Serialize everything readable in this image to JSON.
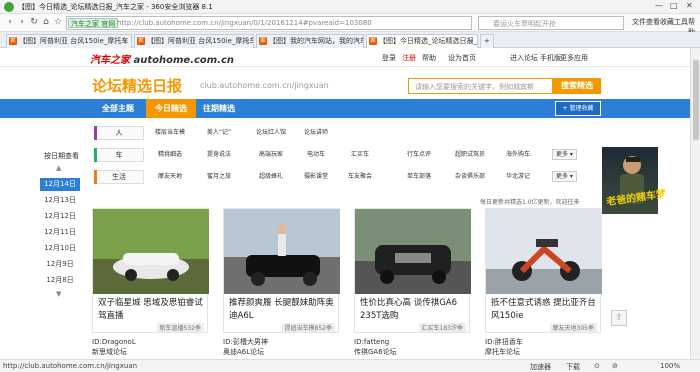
{
  "window": {
    "title": "【图】今日精选_论坛精选日报_汽车之家 - 360安全浏览器 8.1",
    "min": "—",
    "max": "□",
    "close": "✕"
  },
  "nav": {
    "back": "‹",
    "forward": "›",
    "refresh": "↻",
    "home": "⌂",
    "star": "☆",
    "security_pill": "汽车之家 官网",
    "url": "http://club.autohome.com.cn/jingxuan/0/1/20161214#pvareaid=103080",
    "search_placeholder": "春运火车票明起开抢",
    "menu": [
      "文件",
      "查看",
      "收藏",
      "工具",
      "帮助"
    ]
  },
  "tabs": [
    {
      "label": "【图】阿普利亚 台风150ie_摩托车"
    },
    {
      "label": "【图】阿普利亚 台风150ie_摩托车"
    },
    {
      "label": "【图】我的汽车网站，我的汽车之家"
    },
    {
      "label": "【图】今日精选_论坛精选日报_汽车之家"
    }
  ],
  "sitebar": {
    "brand_red": "汽车之家",
    "brand_domain": "autohome.com.cn",
    "links": [
      "登录",
      "注册",
      "帮助",
      "设为首页",
      "进入论坛",
      "手机版",
      "更多应用"
    ]
  },
  "header": {
    "title": "论坛精选日报",
    "subtitle": "club.autohome.com.cn/jingxuan",
    "search_placeholder": "请输入您要搜索的关键字，例如城宾斯",
    "search_button": "搜索精选"
  },
  "catbar": {
    "items": [
      "全部主题",
      "今日精选",
      "往期精选"
    ],
    "manage": "+ 管理收藏"
  },
  "rows": [
    {
      "label": "人",
      "color": "#8e44ad",
      "tags": [
        "楼层当车模",
        "美人“记”",
        "论坛红人馆",
        "论坛讲师"
      ],
      "more": ""
    },
    {
      "label": "车",
      "color": "#27ae60",
      "tags": [
        "精挑细选",
        "提身说法",
        "高端玩家",
        "电动车",
        "汇买车",
        "行车点评",
        "超职试驾员",
        "海外购车"
      ],
      "more": "更多 ▾"
    },
    {
      "label": "生活",
      "color": "#e67e22",
      "tags": [
        "摩友天地",
        "蜜月之旅",
        "超级蜂礼",
        "摄影课堂",
        "车友聚会",
        "单车部落",
        "杂谈俱乐部",
        "华北游记"
      ],
      "more": "更多 ▾"
    }
  ],
  "dates": {
    "title": "按日期查看",
    "up": "▲",
    "down": "▼",
    "items": [
      "12月14日",
      "12月13日",
      "12月12日",
      "12月11日",
      "12月10日",
      "12月9日",
      "12月8日"
    ]
  },
  "update_note": "每日更新共精选1.0亿更新，欢迎往来",
  "cards": [
    {
      "caption": "双子临星城 思域及思铂睿试驾直播",
      "source": "新车直播532季",
      "user": "ID:DragonoL",
      "forum": "新思域论坛"
    },
    {
      "caption": "推荐颜爽履 长腿靓妹助阵奥迪A6L",
      "source": "提妞当车模852季",
      "user": "ID:彭槽大男神",
      "forum": "奥迪A6L论坛"
    },
    {
      "caption": "性价比真心高 谈传祺GA6 235T选购",
      "source": "汇买车183汐季",
      "user": "ID:fatteng",
      "forum": "传祺GA6论坛"
    },
    {
      "caption": "抵不住意式诱惑 提比亚齐台风150ie",
      "source": "摩友天地305季",
      "user": "ID:胖扭香车",
      "forum": "摩托车论坛"
    }
  ],
  "ad": {
    "text": "老爸的赌车梦"
  },
  "backtop": "⇧",
  "status": {
    "url": "http://club.autohome.com.cn/jingxuan",
    "items": [
      "加速器",
      "下载",
      "⊙",
      "⊘",
      "100%"
    ]
  }
}
